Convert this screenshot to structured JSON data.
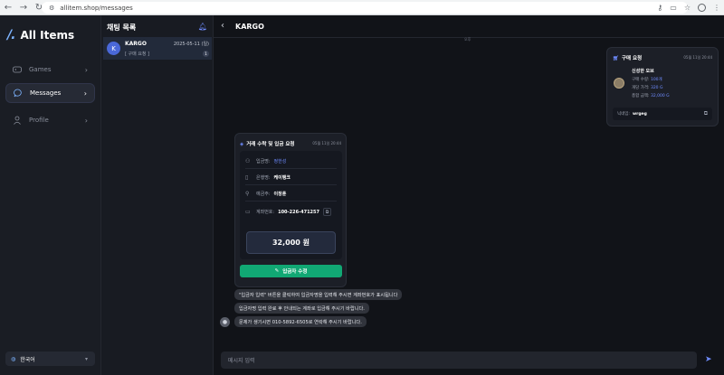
{
  "browser": {
    "url": "allitem.shop/messages"
  },
  "app": {
    "logo_mark": "/.",
    "name": "All Items"
  },
  "sidebar": {
    "items": [
      {
        "label": "Games",
        "icon": "gamepad-icon"
      },
      {
        "label": "Messages",
        "icon": "chat-icon",
        "active": true
      },
      {
        "label": "Profile",
        "icon": "user-icon"
      }
    ],
    "language": "한국어"
  },
  "chatlist": {
    "title": "채팅 목록",
    "items": [
      {
        "avatar": "K",
        "name": "KARGO",
        "date": "2025-05-11 (일)",
        "preview": "[ 구매 요청 ]",
        "badge": "1"
      }
    ]
  },
  "chat": {
    "title": "KARGO",
    "small_time": "오후",
    "purchase_card": {
      "title": "구매 요청",
      "time": "05월 11일 20:44",
      "item_name": "신성한 오브",
      "rows": [
        {
          "label": "구매 수량:",
          "value": "100개"
        },
        {
          "label": "개당 가격:",
          "value": "320 G"
        },
        {
          "label": "총합 금액:",
          "value": "32,000 G"
        }
      ],
      "nickname_label": "닉네임:",
      "nickname": "wrgeg"
    },
    "deposit_card": {
      "title": "거래 수락 및 입금 요청",
      "time": "05월 11일 20:44",
      "fields": [
        {
          "label": "입금명:",
          "value": "정한성"
        },
        {
          "label": "은행명:",
          "value": "케이뱅크"
        },
        {
          "label": "예금주:",
          "value": "이창훈"
        },
        {
          "label": "계좌번호:",
          "value": "100-226-471257"
        }
      ],
      "amount": "32,000 원",
      "button": "입금자 수정"
    },
    "messages": [
      "\"입금자 입력\" 버튼을 클릭하여 입금자명을 입력해 주시면 계좌번호가 표시됩니다",
      "입금자명 입력 완료 후 안내되는 계좌로 입금해 주시기 바랍니다.",
      "문제가 생기시면 010-5892-6505로 연락해 주시기 바랍니다."
    ],
    "input_placeholder": "메시지 입력"
  }
}
